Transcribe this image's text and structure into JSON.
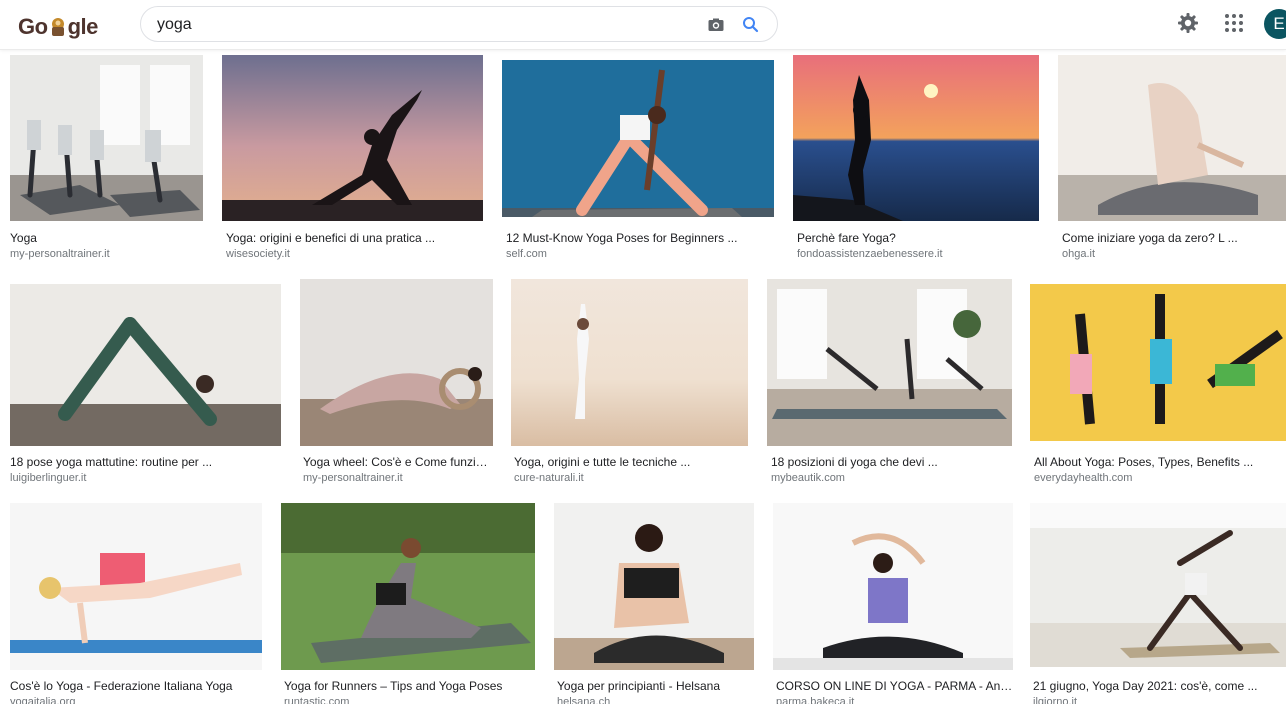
{
  "app": {
    "logo_text_a": "Go",
    "logo_text_b": "gle",
    "accent": "#1a73e8"
  },
  "search": {
    "query": "yoga",
    "placeholder": ""
  },
  "header_icons": [
    "camera-icon",
    "search-icon",
    "gear-icon",
    "apps-grid-icon"
  ],
  "avatar": {
    "initial": "E",
    "color": "#0b5561"
  },
  "results": [
    {
      "title": "Yoga",
      "source": "my-personaltrainer.it"
    },
    {
      "title": "Yoga: origini e benefici di una pratica ...",
      "source": "wisesociety.it"
    },
    {
      "title": "12 Must-Know Yoga Poses for Beginners ...",
      "source": "self.com"
    },
    {
      "title": "Perchè fare Yoga?",
      "source": "fondoassistenzaebenessere.it"
    },
    {
      "title": "Come iniziare yoga da zero? L ...",
      "source": "ohga.it"
    },
    {
      "title": "18 pose yoga mattutine: routine per ...",
      "source": "luigiberlinguer.it"
    },
    {
      "title": "Yoga wheel: Cos'è e Come funzion...",
      "source": "my-personaltrainer.it"
    },
    {
      "title": "Yoga, origini e tutte le tecniche ...",
      "source": "cure-naturali.it"
    },
    {
      "title": "18 posizioni di yoga che devi ...",
      "source": "mybeautik.com"
    },
    {
      "title": "All About Yoga: Poses, Types, Benefits ...",
      "source": "everydayhealth.com"
    },
    {
      "title": "Cos'è lo Yoga - Federazione Italiana Yoga",
      "source": "yogaitalia.org"
    },
    {
      "title": "Yoga for Runners – Tips and Yoga Poses",
      "source": "runtastic.com"
    },
    {
      "title": "Yoga per principianti - Helsana",
      "source": "helsana.ch"
    },
    {
      "title": "CORSO ON LINE DI YOGA - PARMA - Annun...",
      "source": "parma.bakeca.it"
    },
    {
      "title": "21 giugno, Yoga Day 2021: cos'è, come ...",
      "source": "ilgiorno.it"
    }
  ]
}
